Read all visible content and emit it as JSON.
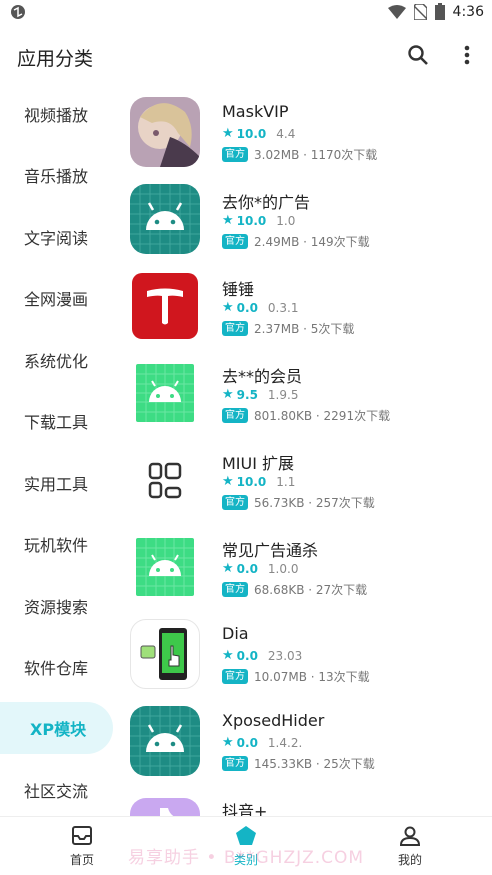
{
  "status_bar": {
    "time": "4:36"
  },
  "header": {
    "title": "应用分类"
  },
  "sidebar": {
    "items": [
      {
        "label": "视频播放"
      },
      {
        "label": "音乐播放"
      },
      {
        "label": "文字阅读"
      },
      {
        "label": "全网漫画"
      },
      {
        "label": "系统优化"
      },
      {
        "label": "下载工具"
      },
      {
        "label": "实用工具"
      },
      {
        "label": "玩机软件"
      },
      {
        "label": "资源搜索"
      },
      {
        "label": "软件仓库"
      },
      {
        "label": "XP模块",
        "active": true
      },
      {
        "label": "社区交流"
      }
    ]
  },
  "apps": [
    {
      "name": "MaskVIP",
      "rating": "10.0",
      "version": "4.4",
      "badge": "官方",
      "info": "3.02MB · 1170次下载",
      "icon": "maskvip-icon"
    },
    {
      "name": "去你*的广告",
      "rating": "10.0",
      "version": "1.0",
      "badge": "官方",
      "info": "2.49MB · 149次下载",
      "icon": "android-icon"
    },
    {
      "name": "锤锤",
      "rating": "0.0",
      "version": "0.3.1",
      "badge": "官方",
      "info": "2.37MB · 5次下载",
      "icon": "hammer-t-icon"
    },
    {
      "name": "去**的会员",
      "rating": "9.5",
      "version": "1.9.5",
      "badge": "官方",
      "info": "801.80KB · 2291次下载",
      "icon": "android-icon"
    },
    {
      "name": "MIUI 扩展",
      "rating": "10.0",
      "version": "1.1",
      "badge": "官方",
      "info": "56.73KB · 257次下载",
      "icon": "grid-icon"
    },
    {
      "name": "常见广告通杀",
      "rating": "0.0",
      "version": "1.0.0",
      "badge": "官方",
      "info": "68.68KB · 27次下载",
      "icon": "android-icon"
    },
    {
      "name": "Dia",
      "rating": "0.0",
      "version": "23.03",
      "badge": "官方",
      "info": "10.07MB · 13次下载",
      "icon": "phone-touch-icon"
    },
    {
      "name": "XposedHider",
      "rating": "0.0",
      "version": "1.4.2.",
      "badge": "官方",
      "info": "145.33KB · 25次下载",
      "icon": "android-icon"
    },
    {
      "name": "抖音+",
      "icon": "douyin-icon"
    }
  ],
  "bottom_nav": {
    "items": [
      {
        "label": "首页",
        "icon": "inbox-icon"
      },
      {
        "label": "类别",
        "icon": "pentagon-icon",
        "active": true
      },
      {
        "label": "我的",
        "icon": "person-icon"
      }
    ],
    "watermark": "易享助手 • B**GHZJZ.COM"
  },
  "colors": {
    "accent": "#14b4c5",
    "active_bg": "#e3f7fa",
    "android_teal": "#1e8c84",
    "android_green": "#3ddc84",
    "hammer_red": "#d0161e"
  }
}
